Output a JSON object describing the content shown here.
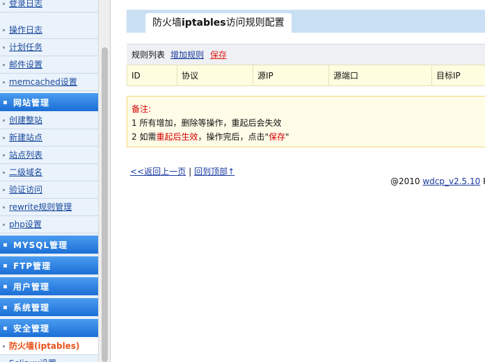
{
  "sidebar": {
    "items_top": [
      {
        "label": "登录日志"
      },
      {
        "label": "操作日志"
      },
      {
        "label": "计划任务"
      },
      {
        "label": "邮件设置"
      },
      {
        "label": "memcached设置"
      }
    ],
    "website_section": "网站管理",
    "website_items": [
      {
        "label": "创建整站"
      },
      {
        "label": "新建站点"
      },
      {
        "label": "站点列表"
      },
      {
        "label": "二级域名"
      },
      {
        "label": "验证访问"
      },
      {
        "label": "rewrite规则管理"
      },
      {
        "label": "php设置"
      }
    ],
    "sections": [
      {
        "label": "MYSQL管理"
      },
      {
        "label": "FTP管理"
      },
      {
        "label": "用户管理"
      },
      {
        "label": "系统管理"
      },
      {
        "label": "安全管理"
      }
    ],
    "active_item": "防火墙(iptables)",
    "cut_item": "Selinux设置"
  },
  "main": {
    "title_prefix": "防火墙",
    "title_bold": "iptables",
    "title_suffix": "访问规则配置",
    "rules_header_label": "规则列表",
    "add_rule": "增加规则",
    "save": "保存",
    "columns": [
      "ID",
      "协议",
      "源IP",
      "源端口",
      "目标IP"
    ],
    "note_title": "备注:",
    "note1": "1 所有增加，删除等操作，重起后会失效",
    "note2_prefix": "2 如需",
    "note2_red": "重起后生效",
    "note2_mid": "，操作完后，点击\"",
    "note2_red2": "保存",
    "note2_end": "\"",
    "back_link": "<<返回上一页",
    "top_link": "回到顶部↑",
    "footer_sep": "|",
    "copyright_prefix": "@2010 ",
    "copyright_link": "wdcp_v2.5.10",
    "copyright_suffix": " Po"
  },
  "colors": {
    "section_blue": "#1c6fd6",
    "link_blue": "#1a3aa0",
    "active_orange": "#e8541c",
    "save_red": "#e0221b"
  }
}
